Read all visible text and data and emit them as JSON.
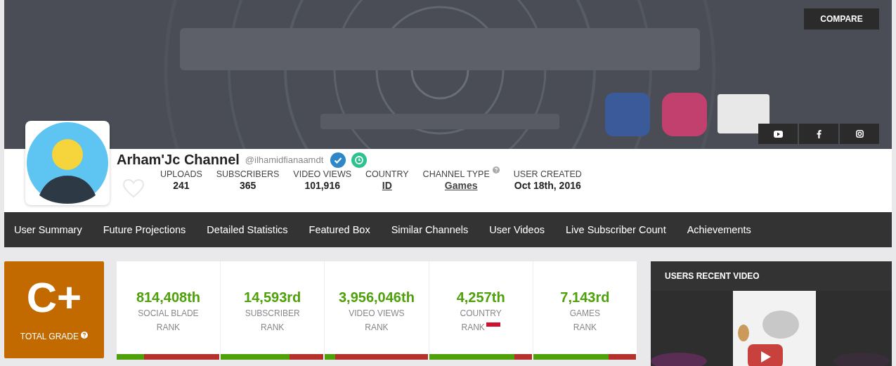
{
  "header": {
    "compare_button": "COMPARE",
    "social_buttons": [
      {
        "kind": "youtube"
      },
      {
        "kind": "facebook"
      },
      {
        "kind": "instagram"
      }
    ]
  },
  "profile": {
    "name": "Arham'Jc Channel",
    "handle": "@ilhamidfianaamdt",
    "favorited": false,
    "stats": [
      {
        "label": "UPLOADS",
        "value": "241",
        "kind": "plain"
      },
      {
        "label": "SUBSCRIBERS",
        "value": "365",
        "kind": "plain"
      },
      {
        "label": "VIDEO VIEWS",
        "value": "101,916",
        "kind": "plain"
      },
      {
        "label": "COUNTRY",
        "value": "ID",
        "kind": "link"
      },
      {
        "label": "CHANNEL TYPE",
        "value": "Games",
        "kind": "link_help"
      },
      {
        "label": "USER CREATED",
        "value": "Oct 18th, 2016",
        "kind": "plain"
      }
    ]
  },
  "nav": [
    {
      "label": "User Summary",
      "selected": false
    },
    {
      "label": "Future Projections",
      "selected": false
    },
    {
      "label": "Detailed Statistics",
      "selected": false
    },
    {
      "label": "Featured Box",
      "selected": false
    },
    {
      "label": "Similar Channels",
      "selected": false
    },
    {
      "label": "User Videos",
      "selected": false
    },
    {
      "label": "Live Subscriber Count",
      "selected": false
    },
    {
      "label": "Achievements",
      "selected": false
    }
  ],
  "grade": {
    "value": "C+",
    "label": "TOTAL GRADE"
  },
  "ranks": [
    {
      "value": "814,408th",
      "label_1": "SOCIAL BLADE",
      "label_2": "RANK",
      "flag": false,
      "level": 0.27
    },
    {
      "value": "14,593rd",
      "label_1": "SUBSCRIBER",
      "label_2": "RANK",
      "flag": false,
      "level": 0.67
    },
    {
      "value": "3,956,046th",
      "label_1": "VIDEO VIEWS",
      "label_2": "RANK",
      "flag": false,
      "level": 0.1
    },
    {
      "value": "4,257th",
      "label_1": "COUNTRY",
      "label_2": "RANK",
      "flag": true,
      "level": 0.83
    },
    {
      "value": "7,143rd",
      "label_1": "GAMES",
      "label_2": "RANK",
      "flag": false,
      "level": 0.73
    }
  ],
  "recent_video": {
    "title": "USERS RECENT VIDEO"
  }
}
